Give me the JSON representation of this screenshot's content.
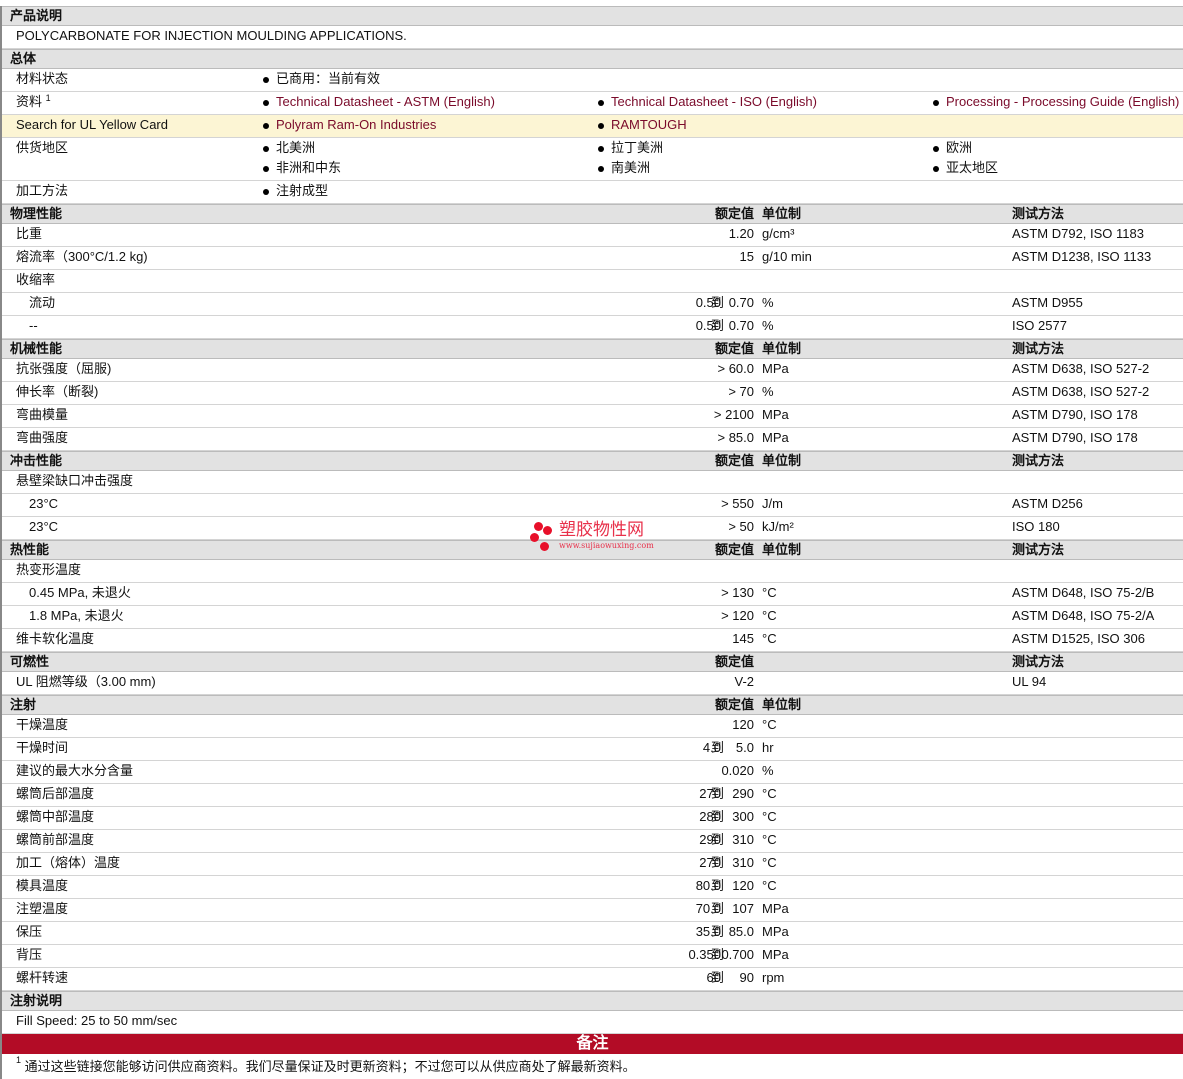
{
  "product_description": {
    "header": "产品说明",
    "text": "POLYCARBONATE FOR INJECTION MOULDING APPLICATIONS."
  },
  "general": {
    "header": "总体",
    "material_status": {
      "label": "材料状态",
      "value": "已商用：当前有效"
    },
    "documents": {
      "label": "资料",
      "sup": "1",
      "links": [
        "Technical Datasheet - ASTM (English)",
        "Technical Datasheet - ISO (English)",
        "Processing - Processing Guide (English)"
      ]
    },
    "ul_card": {
      "label": "Search for UL Yellow Card",
      "links": [
        "Polyram Ram-On Industries",
        "RAMTOUGH"
      ]
    },
    "regions": {
      "label": "供货地区",
      "items": [
        "北美洲",
        "拉丁美洲",
        "欧洲",
        "非洲和中东",
        "南美洲",
        "亚太地区"
      ]
    },
    "processing": {
      "label": "加工方法",
      "value": "注射成型"
    }
  },
  "col_headers": {
    "value": "额定值",
    "unit": "单位制",
    "method": "测试方法",
    "to": "到"
  },
  "sections": [
    {
      "title": "物理性能",
      "unit_hdr": true,
      "rows": [
        {
          "label": "比重",
          "val": "1.20",
          "unit": "g/cm³",
          "method": "ASTM D792, ISO 1183"
        },
        {
          "label": "熔流率（300°C/1.2 kg)",
          "val": "15",
          "unit": "g/10 min",
          "method": "ASTM D1238, ISO 1133"
        },
        {
          "label": "收缩率"
        },
        {
          "label": "流动",
          "indent": true,
          "lo": "0.50",
          "val": "0.70",
          "unit": "%",
          "method": "ASTM D955"
        },
        {
          "label": "--",
          "indent": true,
          "lo": "0.50",
          "val": "0.70",
          "unit": "%",
          "method": "ISO 2577"
        }
      ]
    },
    {
      "title": "机械性能",
      "unit_hdr": true,
      "rows": [
        {
          "label": "抗张强度（屈服)",
          "val": "> 60.0",
          "unit": "MPa",
          "method": "ASTM D638, ISO 527-2"
        },
        {
          "label": "伸长率（断裂)",
          "val": "> 70",
          "unit": "%",
          "method": "ASTM D638, ISO 527-2"
        },
        {
          "label": "弯曲模量",
          "val": "> 2100",
          "unit": "MPa",
          "method": "ASTM D790, ISO 178"
        },
        {
          "label": "弯曲强度",
          "val": "> 85.0",
          "unit": "MPa",
          "method": "ASTM D790, ISO 178"
        }
      ]
    },
    {
      "title": "冲击性能",
      "unit_hdr": true,
      "rows": [
        {
          "label": "悬壁梁缺口冲击强度"
        },
        {
          "label": "23°C",
          "indent": true,
          "val": "> 550",
          "unit": "J/m",
          "method": "ASTM D256"
        },
        {
          "label": "23°C",
          "indent": true,
          "val": "> 50",
          "unit": "kJ/m²",
          "method": "ISO 180"
        }
      ]
    },
    {
      "title": "热性能",
      "unit_hdr": true,
      "rows": [
        {
          "label": "热变形温度"
        },
        {
          "label": "0.45 MPa, 未退火",
          "indent": true,
          "val": "> 130",
          "unit": "°C",
          "method": "ASTM D648, ISO 75-2/B"
        },
        {
          "label": "1.8 MPa, 未退火",
          "indent": true,
          "val": "> 120",
          "unit": "°C",
          "method": "ASTM D648, ISO 75-2/A"
        },
        {
          "label": "维卡软化温度",
          "val": "145",
          "unit": "°C",
          "method": "ASTM D1525, ISO 306"
        }
      ]
    },
    {
      "title": "可燃性",
      "unit_hdr": false,
      "rows": [
        {
          "label": "UL 阻燃等级（3.00 mm)",
          "val": "V-2",
          "method": "UL 94"
        }
      ]
    },
    {
      "title": "注射",
      "unit_hdr": true,
      "no_method": true,
      "rows": [
        {
          "label": "干燥温度",
          "val": "120",
          "unit": "°C"
        },
        {
          "label": "干燥时间",
          "lo": "4.0",
          "val": "5.0",
          "unit": "hr"
        },
        {
          "label": "建议的最大水分含量",
          "val": "0.020",
          "unit": "%"
        },
        {
          "label": "螺筒后部温度",
          "lo": "270",
          "val": "290",
          "unit": "°C"
        },
        {
          "label": "螺筒中部温度",
          "lo": "280",
          "val": "300",
          "unit": "°C"
        },
        {
          "label": "螺筒前部温度",
          "lo": "290",
          "val": "310",
          "unit": "°C"
        },
        {
          "label": "加工（熔体）温度",
          "lo": "270",
          "val": "310",
          "unit": "°C"
        },
        {
          "label": "模具温度",
          "lo": "80.0",
          "val": "120",
          "unit": "°C"
        },
        {
          "label": "注塑温度",
          "lo": "70.0",
          "val": "107",
          "unit": "MPa"
        },
        {
          "label": "保压",
          "lo": "35.0",
          "val": "85.0",
          "unit": "MPa"
        },
        {
          "label": "背压",
          "lo": "0.350",
          "val": "0.700",
          "unit": "MPa"
        },
        {
          "label": "螺杆转速",
          "lo": "60",
          "val": "90",
          "unit": "rpm"
        }
      ]
    }
  ],
  "injection_notes": {
    "header": "注射说明",
    "text": "Fill Speed: 25 to 50 mm/sec"
  },
  "notes": {
    "header": "备注",
    "sup": "1",
    "text": "通过这些链接您能够访问供应商资料。我们尽量保证及时更新资料；不过您可以从供应商处了解最新资料。"
  },
  "watermark": {
    "title": "塑胶物性网",
    "url": "www.sujiaowuxing.com"
  },
  "colors": {
    "link": "#7a0a2a",
    "banner": "#b30c26",
    "highlight": "#fcf5d4"
  }
}
